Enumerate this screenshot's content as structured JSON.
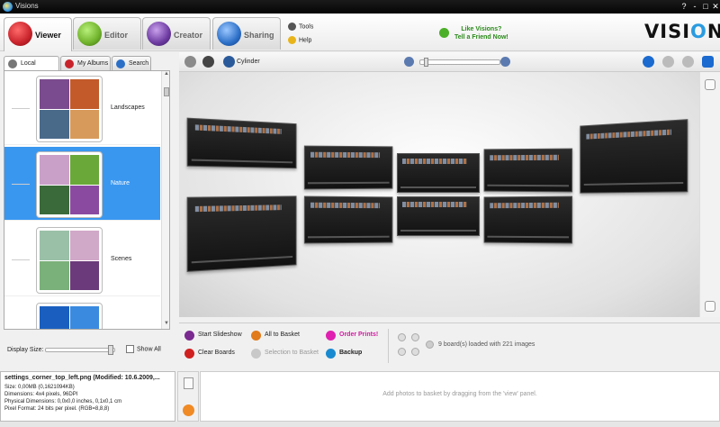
{
  "window": {
    "title": "Visions",
    "controls": [
      "?",
      "-",
      "□",
      "✕"
    ]
  },
  "tabs": [
    {
      "label": "Viewer",
      "color": "#c8232b"
    },
    {
      "label": "Editor",
      "color": "#6fb12b"
    },
    {
      "label": "Creator",
      "color": "#6c3aa0"
    },
    {
      "label": "Sharing",
      "color": "#2c6fc7"
    }
  ],
  "top_links": {
    "tools": "Tools",
    "help": "Help"
  },
  "promo": {
    "line1": "Like Visions?",
    "line2": "Tell a Friend Now!"
  },
  "logo": {
    "text_a": "VISI",
    "text_o": "O",
    "text_b": "NS"
  },
  "left_tabs": [
    {
      "label": "Local Folders"
    },
    {
      "label": "My Albums"
    },
    {
      "label": "Search"
    }
  ],
  "folders": [
    {
      "name": "Landscapes",
      "colors": [
        "#7a4b8e",
        "#c25a2a",
        "#4a6a8a",
        "#d89a5a"
      ]
    },
    {
      "name": "Nature",
      "colors": [
        "#c9a0c8",
        "#6aa83a",
        "#3a6a3a",
        "#8a4aa0"
      ]
    },
    {
      "name": "Scenes",
      "colors": [
        "#9ac0a8",
        "#d0a8c8",
        "#7ab07a",
        "#6a3a7a"
      ]
    },
    {
      "name": "",
      "colors": [
        "#1a5fc0",
        "#3a8ae0",
        "#1a5fc0",
        "#3a8ae0"
      ]
    }
  ],
  "left_bottom": {
    "display_size": "Display Size:",
    "show_all": "Show All"
  },
  "viewer": {
    "mode": "Cylinder",
    "zoom_fraction": 0.05
  },
  "actions": {
    "start_slideshow": "Start Slideshow",
    "all_to_basket": "All to Basket",
    "order_prints": "Order Prints!",
    "clear_boards": "Clear Boards",
    "selection_to_basket": "Selection to Basket",
    "backup": "Backup",
    "boards_info": "9 board(s) loaded with 221 images"
  },
  "status": {
    "filename": "settings_corner_top_left.png (Modified: 10.6.2009,...",
    "size": "Size: 0,00MB (0,1621094KB)",
    "dimensions": "Dimensions: 4x4 pixels, 96DPI",
    "physical": "Physical Dimensions: 0,0x0,0 inches, 0,1x0,1 cm",
    "pixel_format": "Pixel Format: 24 bits per pixel. (RGB=8,8,8)"
  },
  "basket": {
    "hint": "Add photos to basket by dragging from the 'view' panel."
  }
}
